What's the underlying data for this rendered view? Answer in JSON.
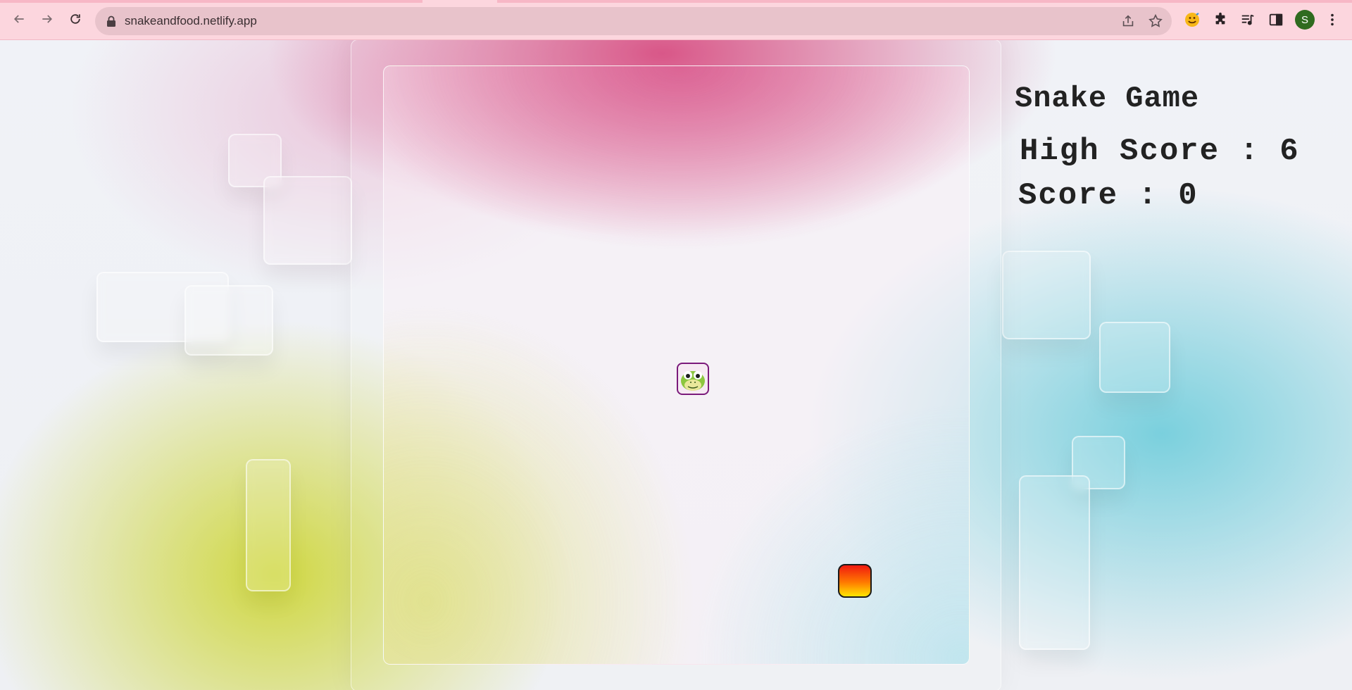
{
  "browser": {
    "url": "snakeandfood.netlify.app",
    "profile_initial": "S",
    "icons": [
      "back-arrow-icon",
      "forward-arrow-icon",
      "reload-icon",
      "lock-icon",
      "share-icon",
      "star-icon",
      "emoji-extension-icon",
      "puzzle-extension-icon",
      "media-control-icon",
      "side-panel-icon",
      "menu-kebab-icon"
    ],
    "avatar_color": "#2f6b1f"
  },
  "game": {
    "title": "Snake Game",
    "high_score_label": "High Score : ",
    "high_score": "6",
    "score_label": "Score : ",
    "score": "0",
    "food_colors": [
      "#f01a10",
      "#ff7a00",
      "#ffe600"
    ],
    "snake_border_color": "#7b1a7b"
  }
}
